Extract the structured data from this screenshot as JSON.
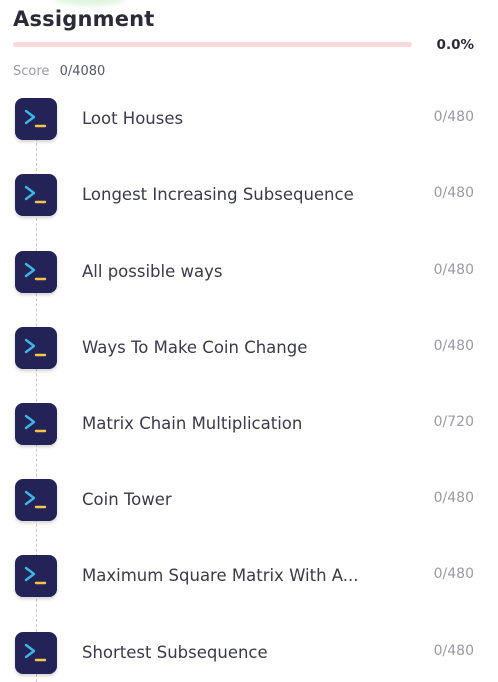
{
  "header": {
    "title": "Assignment",
    "percent_label": "0.0%",
    "progress_fraction": 0.0,
    "score_label": "Score",
    "score_value": "0/4080"
  },
  "colors": {
    "progress_track": "#fcd9d9",
    "progress_fill": "#e05a5a",
    "icon_tile": "#232357",
    "icon_chevron": "#3fb6e8",
    "icon_underscore": "#f4c74a"
  },
  "items": [
    {
      "label": "Loot Houses",
      "score": "0/480",
      "icon": "terminal-icon"
    },
    {
      "label": "Longest Increasing Subsequence",
      "score": "0/480",
      "icon": "terminal-icon"
    },
    {
      "label": "All possible ways",
      "score": "0/480",
      "icon": "terminal-icon"
    },
    {
      "label": "Ways To Make Coin Change",
      "score": "0/480",
      "icon": "terminal-icon"
    },
    {
      "label": "Matrix Chain Multiplication",
      "score": "0/720",
      "icon": "terminal-icon"
    },
    {
      "label": "Coin Tower",
      "score": "0/480",
      "icon": "terminal-icon"
    },
    {
      "label": "Maximum Square Matrix With A...",
      "score": "0/480",
      "icon": "terminal-icon"
    },
    {
      "label": "Shortest Subsequence",
      "score": "0/480",
      "icon": "terminal-icon"
    }
  ]
}
